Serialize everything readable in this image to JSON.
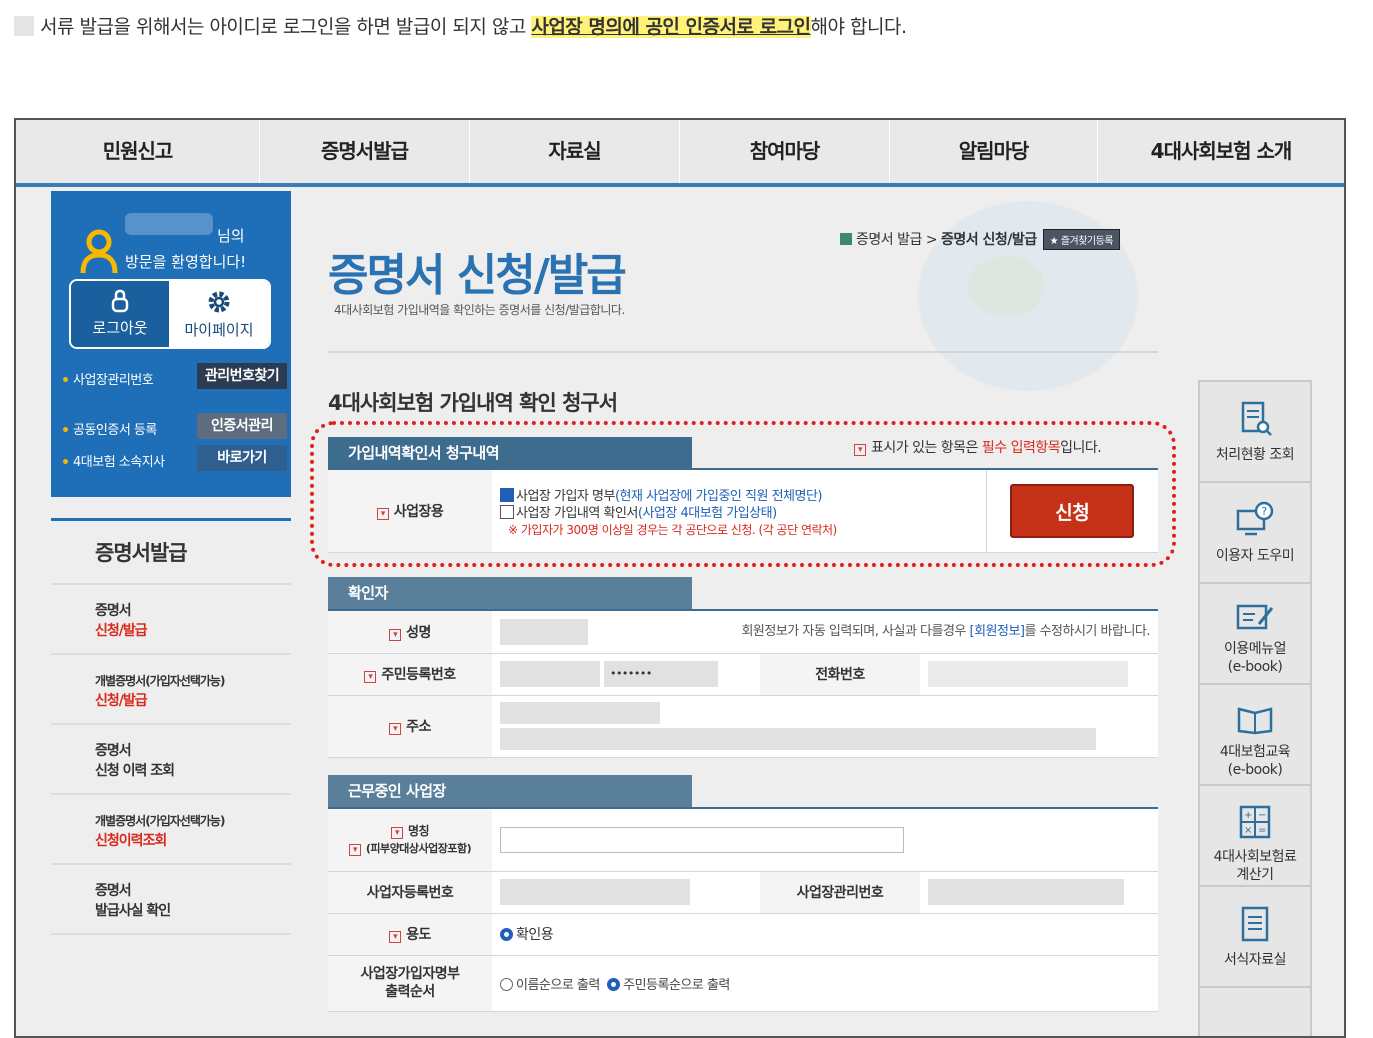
{
  "intro": {
    "before": "서류 발급을 위해서는 아이디로 로그인을 하면 발급이 되지 않고 ",
    "highlight": "사업장 명의에 공인 인증서로 로그인",
    "after": "해야 합니다."
  },
  "gnb": [
    "민원신고",
    "증명서발급",
    "자료실",
    "참여마당",
    "알림마당",
    "4대사회보험 소개"
  ],
  "user": {
    "nim": "님의",
    "welcome": "방문을 환영합니다!",
    "logout": "로그아웃",
    "mypage": "마이페이지",
    "rows": [
      {
        "label": "사업장관리번호",
        "button": "관리번호찾기"
      },
      {
        "label": "공동인증서 등록",
        "button": "인증서관리"
      },
      {
        "label": "4대보험 소속지사",
        "button": "바로가기"
      }
    ]
  },
  "lnb": {
    "title": "증명서발급",
    "items": [
      {
        "line1": "증명서",
        "line2": "신청/발급"
      },
      {
        "line1": "개별증명서(가입자선택가능)",
        "line2": "신청/발급"
      },
      {
        "line1": "증명서",
        "line2": "신청 이력 조회"
      },
      {
        "line1": "개별증명서(가입자선택가능)",
        "line2": "신청이력조회"
      },
      {
        "line1": "증명서",
        "line2": "발급사실 확인"
      }
    ]
  },
  "breadcrumb": {
    "part1": "증명서 발급",
    "sep": ">",
    "part2": "증명서 신청/발급",
    "fav": "★ 즐겨찾기등록"
  },
  "page": {
    "title": "증명서 신청/발급",
    "desc": "4대사회보험 가입내역을 확인하는 증명서를 신청/발급합니다.",
    "form_title": "4대사회보험 가입내역 확인 청구서"
  },
  "section1": {
    "tab": "가입내역확인서 청구내역",
    "req_pre": "표시가 있는 항목은 ",
    "req_red": "필수 입력항목",
    "req_post": "입니다.",
    "label": "사업장용",
    "opt1": "사업장 가입자 명부",
    "opt1_note": "(현재 사업장에 가입중인 직원 전체명단)",
    "opt2": "사업장 가입내역 확인서",
    "opt2_note": "(사업장 4대보험 가입상태)",
    "warn": "※ 가입자가 300명 이상일 경우는 각 공단으로 신청. (각 공단 연락처)",
    "apply": "신청"
  },
  "section2": {
    "tab": "확인자",
    "name_label": "성명",
    "name_note_pre": "회원정보가 자동 입력되며, 사실과 다를경우 ",
    "name_note_link": "[회원정보]",
    "name_note_post": "를 수정하시기 바랍니다.",
    "rrn_label": "주민등록번호",
    "rrn_mask": "•••••••",
    "phone_label": "전화번호",
    "addr_label": "주소"
  },
  "section3": {
    "tab": "근무중인 사업장",
    "name_label": "명칭",
    "name_sub": "(피부양대상사업장포함)",
    "bizno_label": "사업자등록번호",
    "mgmt_label": "사업장관리번호",
    "purpose_label": "용도",
    "purpose_value": "확인용",
    "order_label1": "사업장가입자명부",
    "order_label2": "출력순서",
    "order_opt1": "이름순으로 출력",
    "order_opt2": "주민등록순으로 출력"
  },
  "sidebar": [
    {
      "l1": "처리현황 조회",
      "l2": "",
      "icon": "document-search-icon"
    },
    {
      "l1": "이용자 도우미",
      "l2": "",
      "icon": "help-monitor-icon"
    },
    {
      "l1": "이용메뉴얼",
      "l2": "(e-book)",
      "icon": "manual-edit-icon"
    },
    {
      "l1": "4대보험교육",
      "l2": "(e-book)",
      "icon": "book-icon"
    },
    {
      "l1": "4대사회보험료",
      "l2": "계산기",
      "icon": "calculator-icon"
    },
    {
      "l1": "서식자료실",
      "l2": "",
      "icon": "form-document-icon"
    }
  ],
  "colors": {
    "accent": "#2b72b3",
    "nav_border": "#3a7cb5",
    "apply": "#c53218",
    "required": "#d9281c",
    "highlight": "#fff27a"
  }
}
